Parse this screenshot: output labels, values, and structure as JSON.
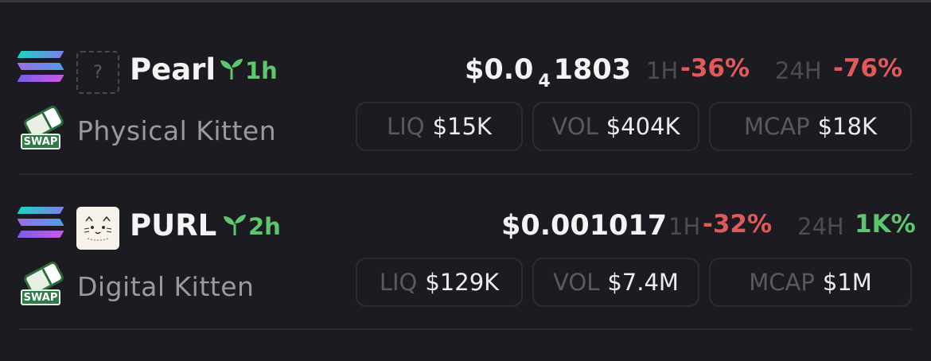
{
  "tokens": [
    {
      "ticker": "Pearl",
      "age": "1h",
      "full_name": "Physical Kitten",
      "image_placeholder": "?",
      "swap_badge": "SWAP",
      "price_prefix": "$0.0",
      "price_zeros": "4",
      "price_digits": "1803",
      "change_1h_label": "1H",
      "change_1h": "-36%",
      "change_24h_label": "24H",
      "change_24h": "-76%",
      "liq_label": "LIQ",
      "liq": "$15K",
      "vol_label": "VOL",
      "vol": "$404K",
      "mcap_label": "MCAP",
      "mcap": "$18K"
    },
    {
      "ticker": "PURL",
      "age": "2h",
      "full_name": "Digital Kitten",
      "swap_badge": "SWAP",
      "price": "$0.001017",
      "change_1h_label": "1H",
      "change_1h": "-32%",
      "change_24h_label": "24H",
      "change_24h": "1K%",
      "liq_label": "LIQ",
      "liq": "$129K",
      "vol_label": "VOL",
      "vol": "$7.4M",
      "mcap_label": "MCAP",
      "mcap": "$1M"
    }
  ],
  "colors": {
    "positive": "#5cc76e",
    "negative": "#e05a5a",
    "background": "#1c1b21"
  },
  "icons": {
    "chain": "solana-icon",
    "dex": "swap-eraser-icon",
    "age": "sprout-icon"
  }
}
